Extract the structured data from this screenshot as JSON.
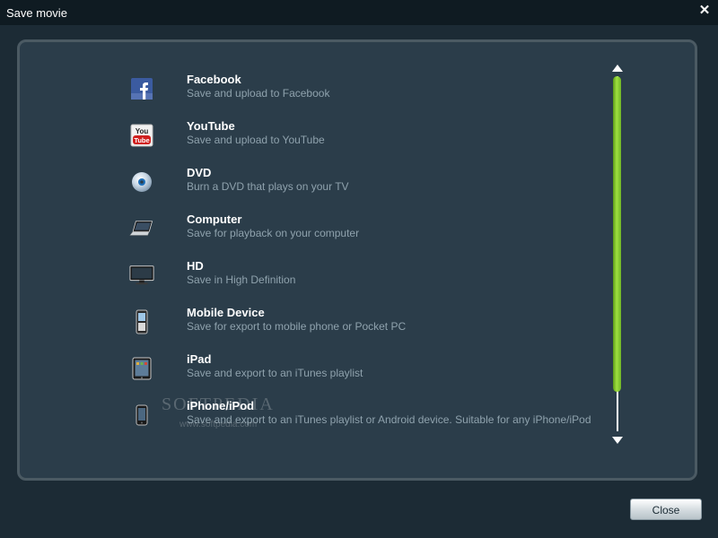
{
  "window": {
    "title": "Save movie",
    "close_glyph": "✕"
  },
  "items": [
    {
      "name": "Facebook",
      "desc": "Save and upload to Facebook",
      "icon": "facebook-icon"
    },
    {
      "name": "YouTube",
      "desc": "Save and upload to YouTube",
      "icon": "youtube-icon"
    },
    {
      "name": "DVD",
      "desc": "Burn a DVD that plays on your TV",
      "icon": "dvd-icon"
    },
    {
      "name": "Computer",
      "desc": "Save for playback on your computer",
      "icon": "laptop-icon"
    },
    {
      "name": "HD",
      "desc": "Save in High Definition",
      "icon": "monitor-icon"
    },
    {
      "name": "Mobile Device",
      "desc": "Save for export to mobile phone or Pocket PC",
      "icon": "mobile-phone-icon"
    },
    {
      "name": "iPad",
      "desc": "Save and export to an iTunes playlist",
      "icon": "ipad-icon"
    },
    {
      "name": "iPhone/iPod",
      "desc": "Save and export to an iTunes playlist or Android device. Suitable for any iPhone/iPod",
      "icon": "iphone-icon"
    }
  ],
  "watermark": {
    "text": "SOFTPEDIA",
    "sub": "www.softpedia.com"
  },
  "youtube_icon": {
    "top": "You",
    "bottom": "Tube"
  },
  "footer": {
    "close_label": "Close"
  },
  "colors": {
    "accent": "#8fd735",
    "panel": "#2b3d4a",
    "titlebar": "#0f1b22"
  }
}
